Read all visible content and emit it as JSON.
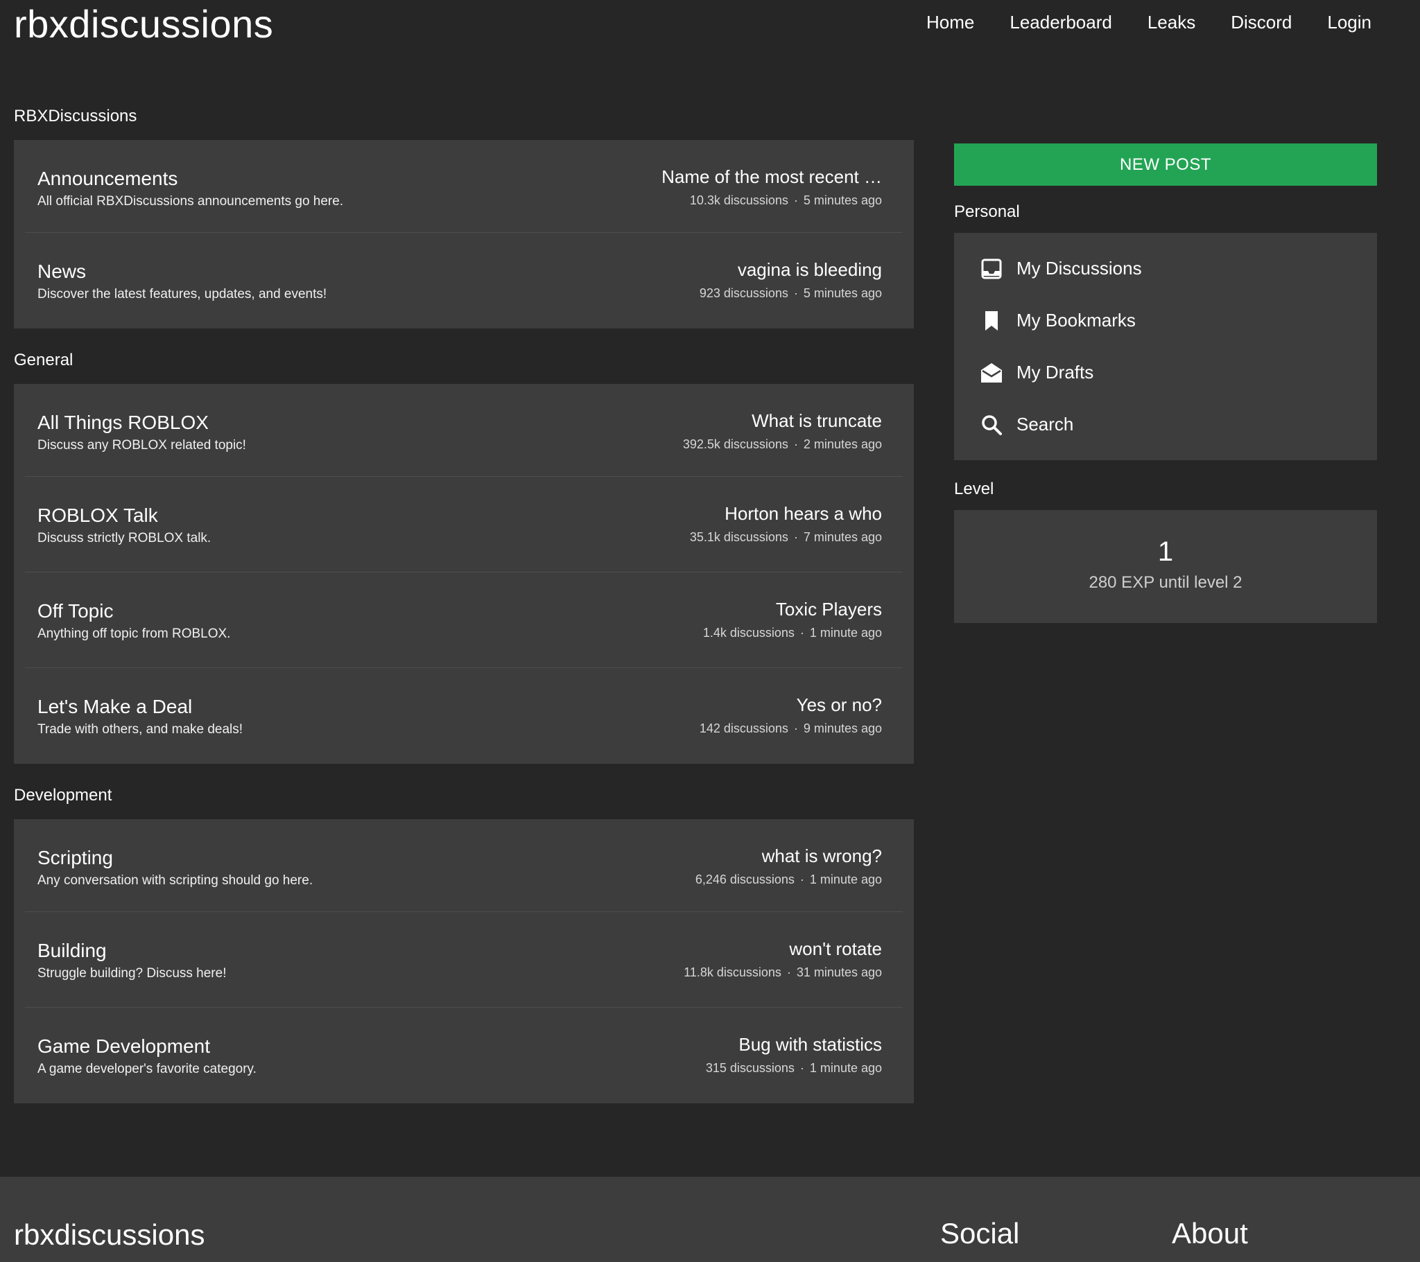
{
  "header": {
    "brand": "rbxdiscussions",
    "nav": [
      "Home",
      "Leaderboard",
      "Leaks",
      "Discord",
      "Login"
    ]
  },
  "sections": [
    {
      "title": "RBXDiscussions",
      "categories": [
        {
          "title": "Announcements",
          "description": "All official RBXDiscussions announcements go here.",
          "recent": "Name of the most recent …",
          "discussions": "10.3k discussions",
          "time": "5 minutes ago"
        },
        {
          "title": "News",
          "description": "Discover the latest features, updates, and events!",
          "recent": "vagina is bleeding",
          "discussions": "923 discussions",
          "time": "5 minutes ago"
        }
      ]
    },
    {
      "title": "General",
      "categories": [
        {
          "title": "All Things ROBLOX",
          "description": "Discuss any ROBLOX related topic!",
          "recent": "What is truncate",
          "discussions": "392.5k discussions",
          "time": "2 minutes ago"
        },
        {
          "title": "ROBLOX Talk",
          "description": "Discuss strictly ROBLOX talk.",
          "recent": "Horton hears a who",
          "discussions": "35.1k discussions",
          "time": "7 minutes ago"
        },
        {
          "title": "Off Topic",
          "description": "Anything off topic from ROBLOX.",
          "recent": "Toxic Players",
          "discussions": "1.4k discussions",
          "time": "1 minute ago"
        },
        {
          "title": "Let's Make a Deal",
          "description": "Trade with others, and make deals!",
          "recent": "Yes or no?",
          "discussions": "142 discussions",
          "time": "9 minutes ago"
        }
      ]
    },
    {
      "title": "Development",
      "categories": [
        {
          "title": "Scripting",
          "description": "Any conversation with scripting should go here.",
          "recent": "what is wrong?",
          "discussions": "6,246 discussions",
          "time": "1 minute ago"
        },
        {
          "title": "Building",
          "description": "Struggle building? Discuss here!",
          "recent": "won't rotate",
          "discussions": "11.8k discussions",
          "time": "31 minutes ago"
        },
        {
          "title": "Game Development",
          "description": "A game developer's favorite category.",
          "recent": "Bug with statistics",
          "discussions": "315 discussions",
          "time": "1 minute ago"
        }
      ]
    }
  ],
  "sidebar": {
    "new_post": "NEW POST",
    "personal_title": "Personal",
    "personal_items": [
      {
        "label": "My Discussions",
        "icon": "inbox-icon"
      },
      {
        "label": "My Bookmarks",
        "icon": "bookmark-icon"
      },
      {
        "label": "My Drafts",
        "icon": "drafts-icon"
      },
      {
        "label": "Search",
        "icon": "search-icon"
      }
    ],
    "level_title": "Level",
    "level_value": "1",
    "level_progress": "280 EXP until level 2"
  },
  "footer": {
    "brand": "rbxdiscussions",
    "social": "Social",
    "about": "About"
  },
  "colors": {
    "background": "#262626",
    "panel": "#3d3d3d",
    "accent_green": "#23a455"
  }
}
